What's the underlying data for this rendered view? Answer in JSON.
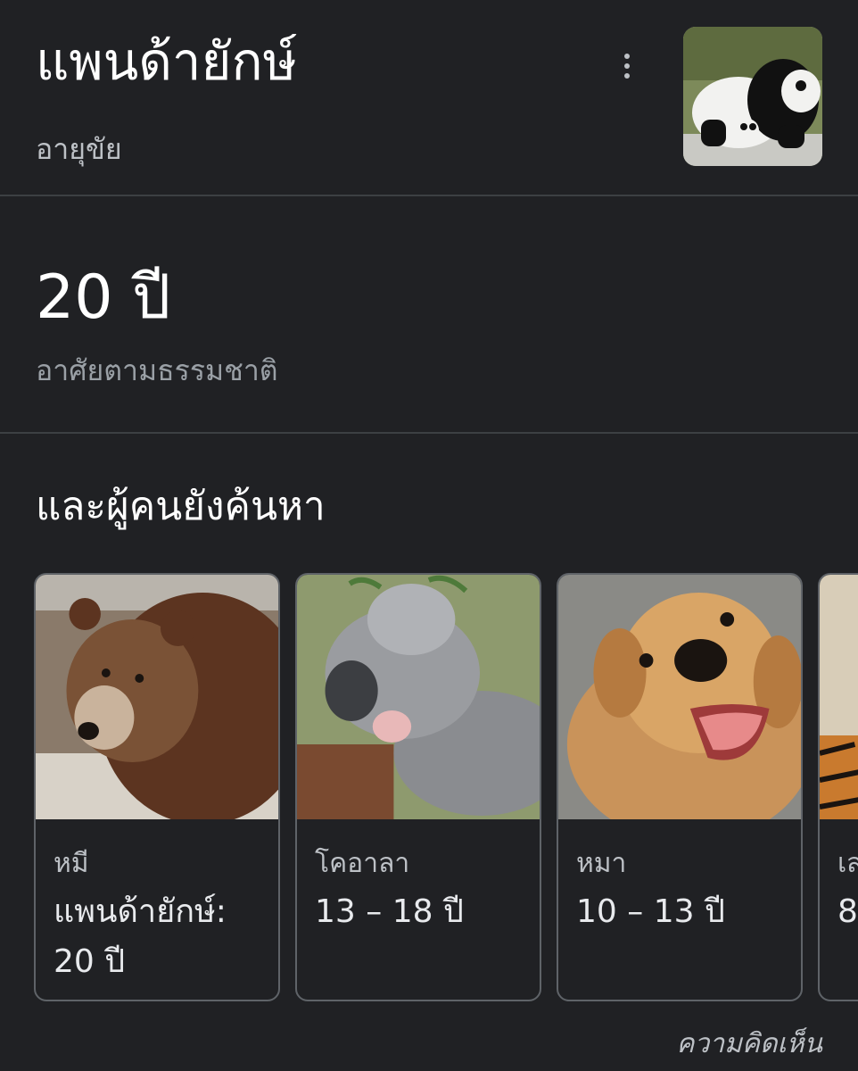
{
  "header": {
    "title": "แพนด้ายักษ์",
    "subtitle": "อายุขัย",
    "thumbnail": "giant-panda-photo"
  },
  "answer": {
    "value": "20 ปี",
    "caption": "อาศัยตามธรรมชาติ"
  },
  "related": {
    "title": "และผู้คนยังค้นหา",
    "cards": [
      {
        "category": "หมี",
        "value": "แพนด้ายักษ์: 20 ปี",
        "image": "brown-bear-photo"
      },
      {
        "category": "โคอาลา",
        "value": "13 – 18 ปี",
        "image": "koala-photo"
      },
      {
        "category": "หมา",
        "value": "10 – 13 ปี",
        "image": "golden-retriever-photo"
      },
      {
        "category": "เส",
        "value": "8",
        "image": "tiger-photo"
      }
    ]
  },
  "footer": {
    "feedback": "ความคิดเห็น"
  },
  "colors": {
    "background": "#202124",
    "divider": "#3c4043",
    "card_border": "#5f6368",
    "text_primary": "#ffffff",
    "text_secondary": "#bdc1c6"
  }
}
